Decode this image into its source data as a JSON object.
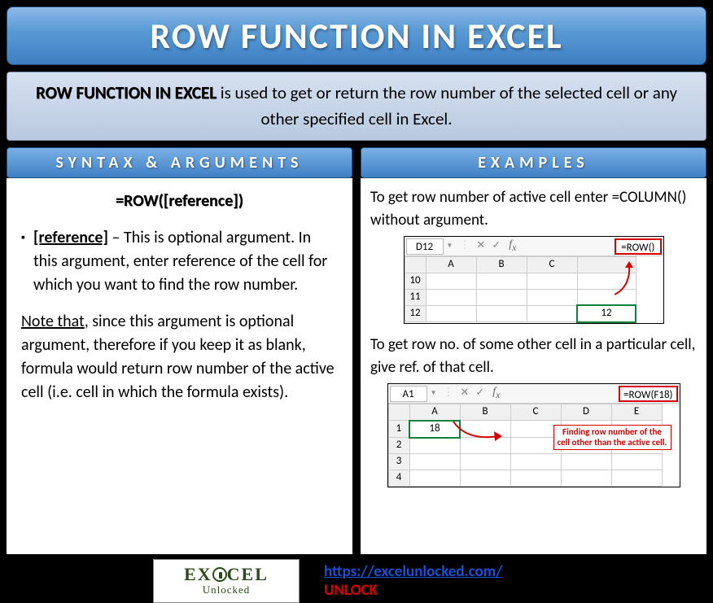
{
  "title": "ROW FUNCTION IN EXCEL",
  "intro": {
    "bold": "ROW FUNCTION IN EXCEL",
    "rest": " is used to get or return the row number of the selected cell or any other specified cell in Excel."
  },
  "syntax": {
    "header": "SYNTAX & ARGUMENTS",
    "formula": "=ROW([reference])",
    "arg_label": "[reference]",
    "arg_desc": " – This is optional argument. In this argument, enter reference of the cell for which you want to find the row number.",
    "note_label": "Note that",
    "note_rest": ", since this argument is optional argument, therefore if you keep it as blank, formula would return row number of the active cell (i.e. cell in which the formula exists)."
  },
  "examples": {
    "header": "EXAMPLES",
    "ex1_text": "To get row number of active cell enter =COLUMN() without argument.",
    "ex2_text": "To get row no. of some other cell in a particular cell, give ref. of that cell.",
    "annotation": "Finding row number of the cell other than the active cell."
  },
  "mini1": {
    "namebox": "D12",
    "formula": "=ROW()",
    "cols": [
      "A",
      "B",
      "C",
      ""
    ],
    "rows": [
      "10",
      "11",
      "12"
    ],
    "result": "12"
  },
  "mini2": {
    "namebox": "A1",
    "formula": "=ROW(F18)",
    "cols": [
      "A",
      "B",
      "C",
      "D",
      "E"
    ],
    "rows": [
      "1",
      "2",
      "3",
      "4"
    ],
    "result": "18"
  },
  "footer": {
    "logo_top": "EXCEL",
    "logo_bot": "Unlocked",
    "url": "https://excelunlocked.com/",
    "unlock": "UNLOCK"
  }
}
